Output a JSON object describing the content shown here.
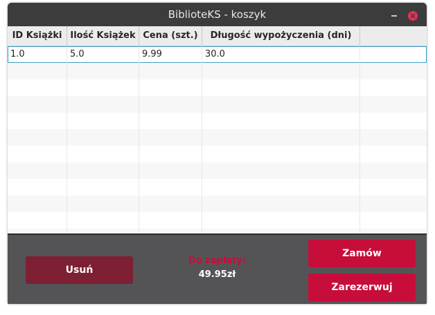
{
  "window": {
    "title": "BiblioteKS - koszyk",
    "close_glyph": "×"
  },
  "table": {
    "columns": [
      "ID Książki",
      "Ilość Książek",
      "Cena (szt.)",
      "Długość wypożyczenia (dni)"
    ],
    "rows": [
      [
        "1.0",
        "5.0",
        "9.99",
        "30.0"
      ]
    ]
  },
  "footer": {
    "remove_label": "Usuń",
    "pay_label": "Do zapłaty:",
    "pay_value": "49.95zł",
    "order_label": "Zamów",
    "reserve_label": "Zarezerwuj"
  },
  "colors": {
    "accent": "#c70d3a",
    "accent_dark": "#7d2034",
    "panel": "#545456"
  }
}
